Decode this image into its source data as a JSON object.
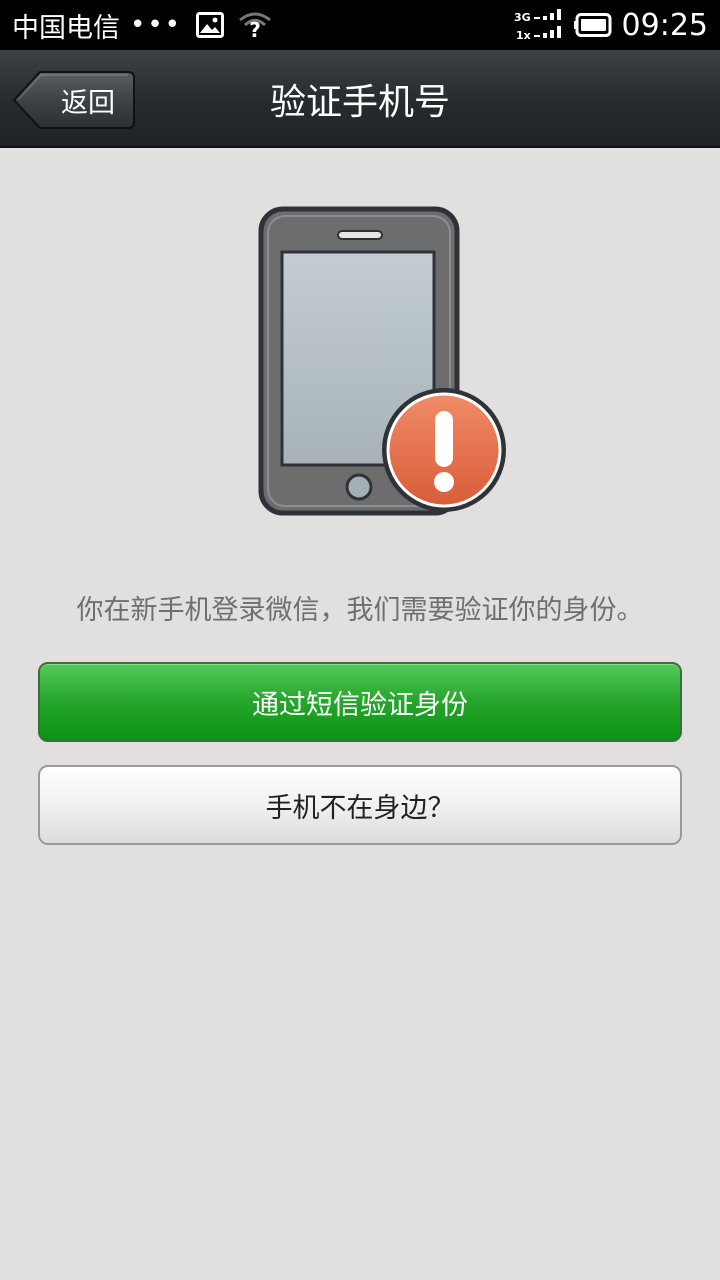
{
  "status_bar": {
    "carrier": "中国电信",
    "dots": "•••",
    "network_top": "3G",
    "network_bottom": "1x",
    "time": "09:25",
    "icons": [
      "gallery-icon",
      "wifi-unknown-icon",
      "signal-icon",
      "battery-icon"
    ]
  },
  "title_bar": {
    "back_label": "返回",
    "title": "验证手机号"
  },
  "illustration": {
    "icon": "phone-warning-icon",
    "warning_symbol": "!",
    "warning_color": "#e36d48"
  },
  "main": {
    "message": "你在新手机登录微信，我们需要验证你的身份。",
    "primary_button": "通过短信验证身份",
    "secondary_button": "手机不在身边？"
  },
  "colors": {
    "background": "#e1e0de",
    "primary_green": "#1ba021",
    "title_bar": "#2a2f32"
  }
}
